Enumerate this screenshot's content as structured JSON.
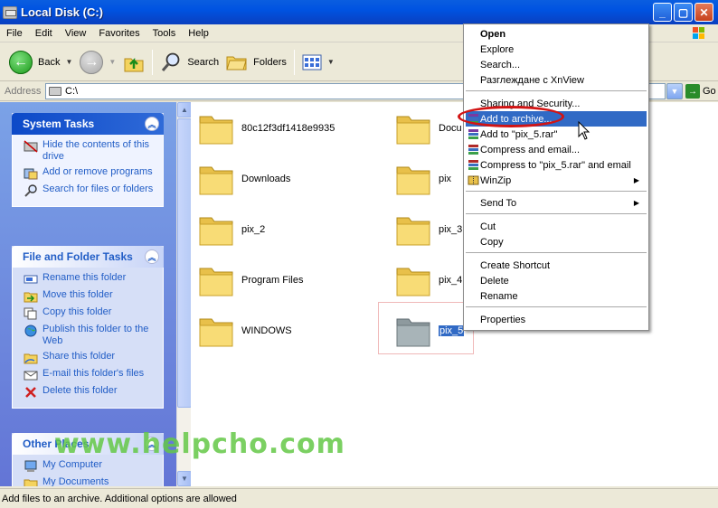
{
  "window": {
    "title": "Local Disk (C:)"
  },
  "menu": [
    "File",
    "Edit",
    "View",
    "Favorites",
    "Tools",
    "Help"
  ],
  "toolbar": {
    "back": "Back",
    "search": "Search",
    "folders": "Folders"
  },
  "address": {
    "label": "Address",
    "value": "C:\\",
    "go": "Go"
  },
  "tasks": {
    "system": {
      "title": "System Tasks",
      "items": [
        "Hide the contents of this drive",
        "Add or remove programs",
        "Search for files or folders"
      ]
    },
    "file_folder": {
      "title": "File and Folder Tasks",
      "items": [
        "Rename this folder",
        "Move this folder",
        "Copy this folder",
        "Publish this folder to the Web",
        "Share this folder",
        "E-mail this folder's files",
        "Delete this folder"
      ]
    },
    "other": {
      "title": "Other Places",
      "items": [
        "My Computer",
        "My Documents"
      ]
    }
  },
  "folders": [
    "80c12f3df1418e9935",
    "Downloads",
    "pix_2",
    "Program Files",
    "WINDOWS",
    "Docu",
    "pix",
    "pix_3",
    "pix_4",
    "pix_5"
  ],
  "context_menu": {
    "items": [
      "Open",
      "Explore",
      "Search...",
      "Разглеждане с XnView",
      "Sharing and Security...",
      "Add to archive...",
      "Add to \"pix_5.rar\"",
      "Compress and email...",
      "Compress to \"pix_5.rar\" and email",
      "WinZip",
      "Send To",
      "Cut",
      "Copy",
      "Create Shortcut",
      "Delete",
      "Rename",
      "Properties"
    ],
    "highlighted": "Add to archive..."
  },
  "watermark": "www.helpcho.com",
  "status": "Add files to an archive. Additional options are allowed"
}
